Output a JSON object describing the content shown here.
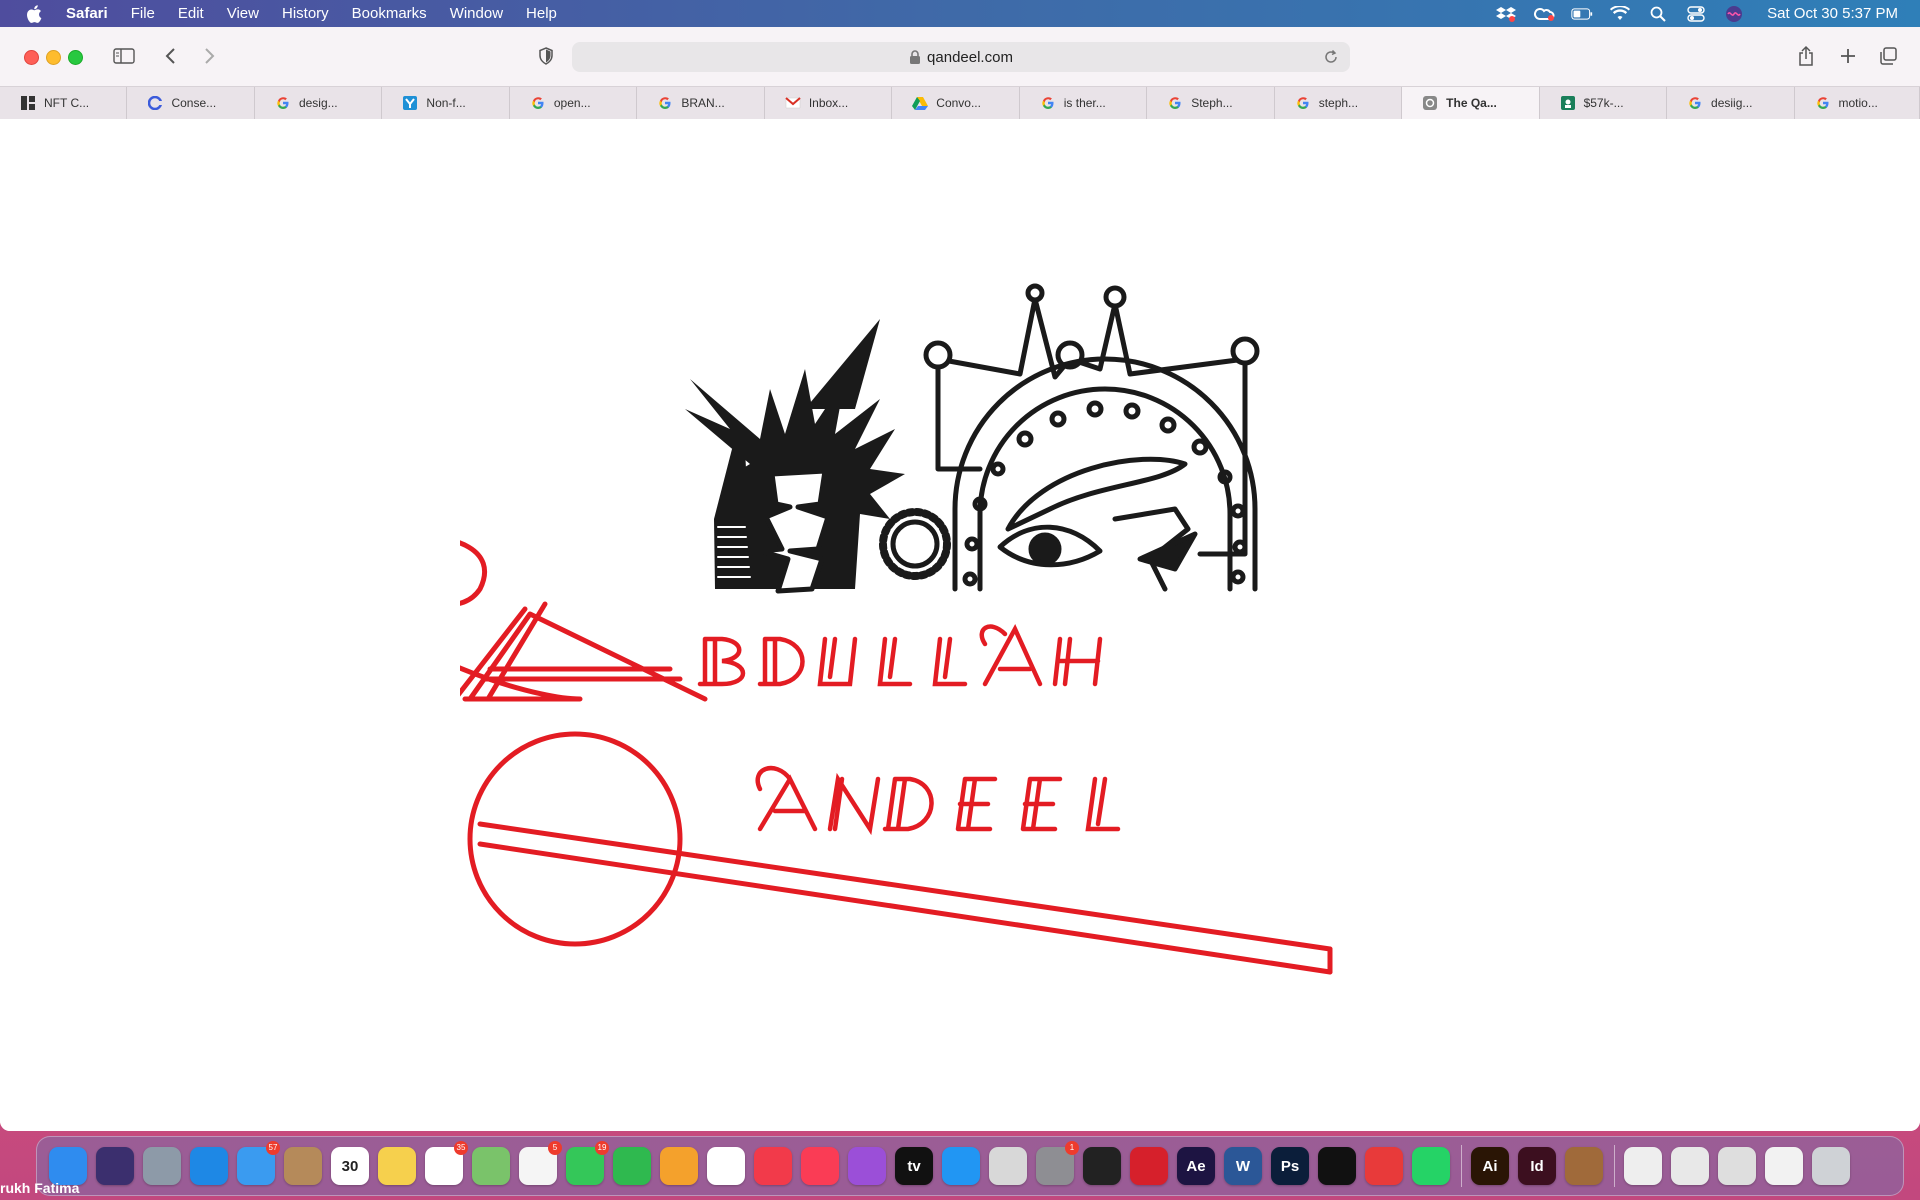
{
  "menubar": {
    "apple_icon": "apple-logo",
    "app_name": "Safari",
    "items": [
      "File",
      "Edit",
      "View",
      "History",
      "Bookmarks",
      "Window",
      "Help"
    ],
    "status_icons": [
      "dropbox-icon",
      "creative-cloud-icon",
      "battery-icon",
      "wifi-icon",
      "spotlight-icon",
      "control-center-icon",
      "siri-icon"
    ],
    "clock": "Sat Oct 30  5:37 PM"
  },
  "toolbar": {
    "url": "qandeel.com"
  },
  "tabs": [
    {
      "label": "NFT C...",
      "icon": "grid-favicon",
      "color": "#333333"
    },
    {
      "label": "Conse...",
      "icon": "c-favicon",
      "color": "#3b5bdb"
    },
    {
      "label": "desig...",
      "icon": "google-favicon",
      "color": "#4285f4"
    },
    {
      "label": "Non-f...",
      "icon": "y-favicon",
      "color": "#1e90d6"
    },
    {
      "label": "open...",
      "icon": "google-favicon",
      "color": "#4285f4"
    },
    {
      "label": "BRAN...",
      "icon": "google-favicon",
      "color": "#4285f4"
    },
    {
      "label": "Inbox...",
      "icon": "gmail-favicon",
      "color": "#d93025"
    },
    {
      "label": "Convo...",
      "icon": "drive-favicon",
      "color": "#0f9d58"
    },
    {
      "label": "is ther...",
      "icon": "google-favicon",
      "color": "#4285f4"
    },
    {
      "label": "Steph...",
      "icon": "google-favicon",
      "color": "#4285f4"
    },
    {
      "label": "steph...",
      "icon": "google-favicon",
      "color": "#4285f4"
    },
    {
      "label": "The Qa...",
      "icon": "q-favicon",
      "color": "#777777",
      "active": true
    },
    {
      "label": "$57k-...",
      "icon": "fiverr-favicon",
      "color": "#1a7f5a"
    },
    {
      "label": "desiig...",
      "icon": "google-favicon",
      "color": "#4285f4"
    },
    {
      "label": "motio...",
      "icon": "google-favicon",
      "color": "#4285f4"
    }
  ],
  "logo": {
    "first_name_rest": "BDULLAH",
    "last_name_rest": "ANDEEL",
    "red_color": "#e31c23",
    "black_color": "#1a1a1a"
  },
  "dock": {
    "user_label": "rukh Fatima",
    "apps": [
      {
        "name": "finder-icon",
        "text": "",
        "bg": "#2f8cef"
      },
      {
        "name": "siri-icon",
        "text": "",
        "bg": "#3b2f6e"
      },
      {
        "name": "launchpad-icon",
        "text": "",
        "bg": "#8d9aa8"
      },
      {
        "name": "safari-icon",
        "text": "",
        "bg": "#1e88e5"
      },
      {
        "name": "mail-icon",
        "text": "",
        "bg": "#3a9bf0",
        "badge": "57"
      },
      {
        "name": "contacts-icon",
        "text": "",
        "bg": "#b58a5a"
      },
      {
        "name": "calendar-icon",
        "text": "30",
        "bg": "#ffffff"
      },
      {
        "name": "notes-icon",
        "text": "",
        "bg": "#f6d04d"
      },
      {
        "name": "reminders-icon",
        "text": "",
        "bg": "#ffffff",
        "badge": "35"
      },
      {
        "name": "maps-icon",
        "text": "",
        "bg": "#7ac36a"
      },
      {
        "name": "photos-icon",
        "text": "",
        "bg": "#f5f5f5",
        "badge": "5"
      },
      {
        "name": "messages-icon",
        "text": "",
        "bg": "#34c759",
        "badge": "19"
      },
      {
        "name": "facetime-icon",
        "text": "",
        "bg": "#2fb94f"
      },
      {
        "name": "pages-icon",
        "text": "",
        "bg": "#f4a12c"
      },
      {
        "name": "numbers-icon",
        "text": "",
        "bg": "#ffffff"
      },
      {
        "name": "news-icon",
        "text": "",
        "bg": "#f23a4a"
      },
      {
        "name": "music-icon",
        "text": "",
        "bg": "#fa3c55"
      },
      {
        "name": "podcasts-icon",
        "text": "",
        "bg": "#9b4fd8"
      },
      {
        "name": "apple-tv-icon",
        "text": "tv",
        "bg": "#111111"
      },
      {
        "name": "app-store-icon",
        "text": "",
        "bg": "#2196f3"
      },
      {
        "name": "screen-time-icon",
        "text": "",
        "bg": "#d8d8d8"
      },
      {
        "name": "system-preferences-icon",
        "text": "",
        "bg": "#8e8e93",
        "badge": "1"
      },
      {
        "name": "nikon-transfer-icon",
        "text": "",
        "bg": "#222222"
      },
      {
        "name": "acrobat-icon",
        "text": "",
        "bg": "#d6202b"
      },
      {
        "name": "after-effects-icon",
        "text": "Ae",
        "bg": "#1d1442"
      },
      {
        "name": "word-icon",
        "text": "W",
        "bg": "#2b5797"
      },
      {
        "name": "photoshop-icon",
        "text": "Ps",
        "bg": "#0b1e3a"
      },
      {
        "name": "nikon-capture-icon",
        "text": "",
        "bg": "#111111"
      },
      {
        "name": "creative-cloud-icon",
        "text": "",
        "bg": "#e83a3a"
      },
      {
        "name": "whatsapp-icon",
        "text": "",
        "bg": "#25d366"
      },
      {
        "name": "illustrator-icon",
        "text": "Ai",
        "bg": "#2a1505"
      },
      {
        "name": "indesign-icon",
        "text": "Id",
        "bg": "#3c0f1f"
      },
      {
        "name": "animal-app-icon",
        "text": "",
        "bg": "#a06a3a"
      },
      {
        "name": "document-stack-icon",
        "text": "",
        "bg": "#eeeeee"
      },
      {
        "name": "downloads-stack-icon",
        "text": "",
        "bg": "#e8e8e8"
      },
      {
        "name": "desktop-stack-icon",
        "text": "",
        "bg": "#dedede"
      },
      {
        "name": "window-thumb-icon",
        "text": "",
        "bg": "#f2f2f2"
      },
      {
        "name": "trash-icon",
        "text": "",
        "bg": "#cfd2d6"
      }
    ]
  }
}
